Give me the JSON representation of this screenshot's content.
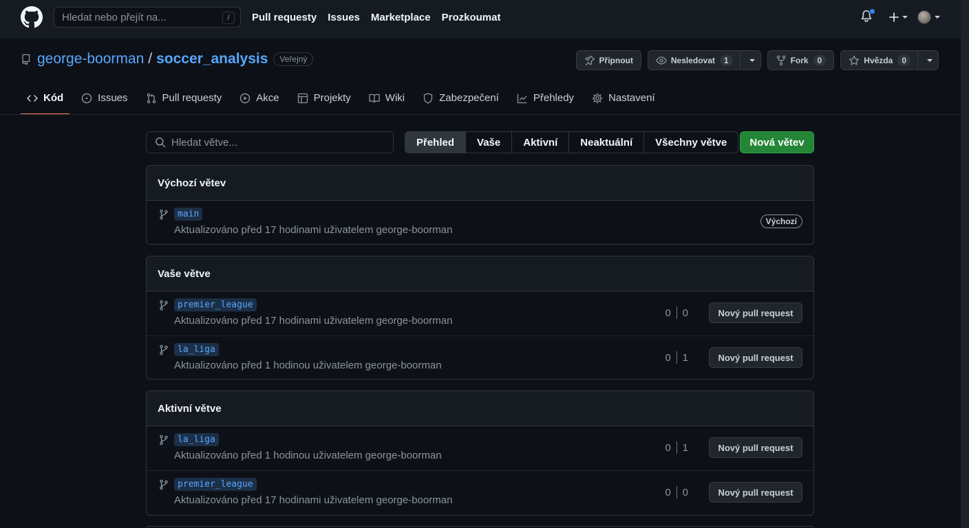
{
  "header": {
    "search_placeholder": "Hledat nebo přejít na...",
    "search_shortcut": "/",
    "nav": [
      "Pull requesty",
      "Issues",
      "Marketplace",
      "Prozkoumat"
    ]
  },
  "repo": {
    "owner": "george-boorman",
    "separator": "/",
    "name": "soccer_analysis",
    "visibility": "Veřejný",
    "actions": {
      "pin_label": "Připnout",
      "watch_label": "Nesledovat",
      "watch_count": "1",
      "fork_label": "Fork",
      "fork_count": "0",
      "star_label": "Hvězda",
      "star_count": "0"
    },
    "tabs": [
      "Kód",
      "Issues",
      "Pull requesty",
      "Akce",
      "Projekty",
      "Wiki",
      "Zabezpečení",
      "Přehledy",
      "Nastavení"
    ]
  },
  "filters": {
    "search_placeholder": "Hledat větve...",
    "segments": [
      "Přehled",
      "Vaše",
      "Aktivní",
      "Neaktuální",
      "Všechny větve"
    ],
    "new_branch_label": "Nová větev"
  },
  "sections": {
    "default": {
      "title": "Výchozí větev",
      "rows": [
        {
          "branch": "main",
          "meta": "Aktualizováno před 17 hodinami uživatelem george-boorman",
          "label": "Výchozí"
        }
      ]
    },
    "yours": {
      "title": "Vaše větve",
      "rows": [
        {
          "branch": "premier_league",
          "meta": "Aktualizováno před 17 hodinami uživatelem george-boorman",
          "behind": "0",
          "ahead": "0",
          "pr_label": "Nový pull request"
        },
        {
          "branch": "la_liga",
          "meta": "Aktualizováno před 1 hodinou uživatelem george-boorman",
          "behind": "0",
          "ahead": "1",
          "pr_label": "Nový pull request"
        }
      ]
    },
    "active": {
      "title": "Aktivní větve",
      "rows": [
        {
          "branch": "la_liga",
          "meta": "Aktualizováno před 1 hodinou uživatelem george-boorman",
          "behind": "0",
          "ahead": "1",
          "pr_label": "Nový pull request"
        },
        {
          "branch": "premier_league",
          "meta": "Aktualizováno před 17 hodinami uživatelem george-boorman",
          "behind": "0",
          "ahead": "0",
          "pr_label": "Nový pull request"
        }
      ]
    }
  },
  "colors": {
    "accent_link": "#58a6ff",
    "primary_button": "#238636",
    "active_tab_underline": "#f78166",
    "notification_dot": "#2f81f7"
  }
}
